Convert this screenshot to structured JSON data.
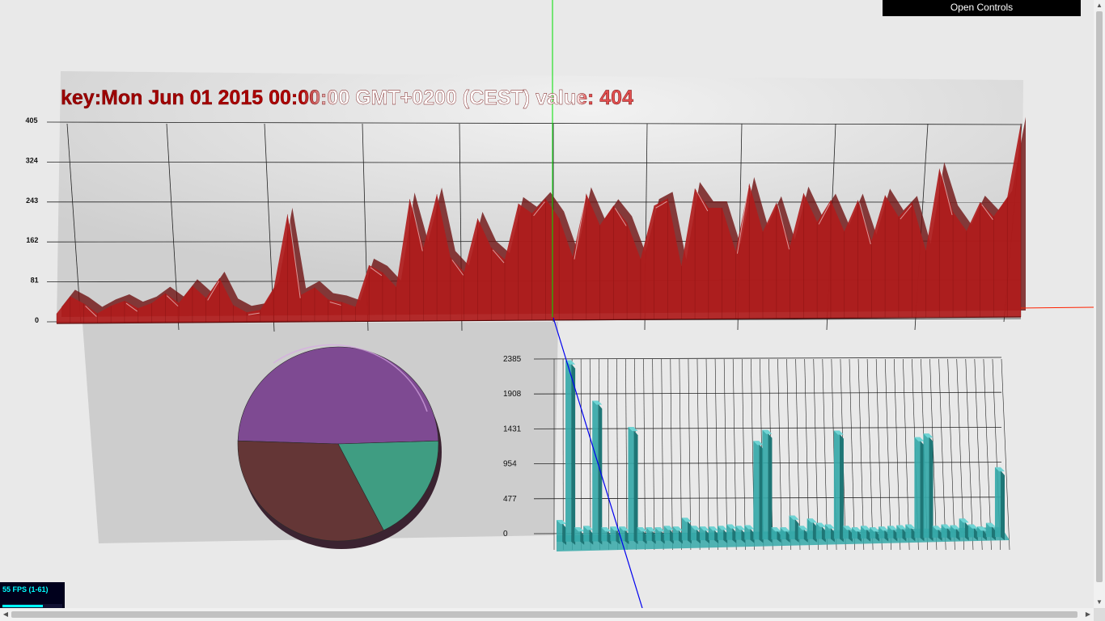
{
  "controls": {
    "open_label": "Open Controls"
  },
  "stats": {
    "fps_label": "55 FPS (1-61)",
    "fps_fill_fraction": 0.68
  },
  "tooltip": {
    "key_prefix": "key:",
    "key_value": "Mon Jun 01 2015 00:00:00 GMT+0200 (CEST)",
    "value_prefix": " value: ",
    "value": "404"
  },
  "colors": {
    "area": "#b01c1c",
    "pie_purple": "#7e4a92",
    "pie_maroon": "#643636",
    "pie_green": "#3f9d82",
    "bars": "#35a8a8",
    "axis_x": "#ff2200",
    "axis_y": "#00e000",
    "axis_z": "#0000ee"
  },
  "chart_data": [
    {
      "type": "area",
      "yticks": [
        "0",
        "81",
        "162",
        "243",
        "324",
        "405"
      ],
      "ylim": [
        0,
        405
      ],
      "grid": true,
      "values": [
        20,
        55,
        40,
        20,
        35,
        45,
        30,
        40,
        60,
        40,
        75,
        50,
        90,
        35,
        20,
        25,
        70,
        220,
        55,
        70,
        45,
        40,
        30,
        115,
        100,
        70,
        250,
        150,
        260,
        130,
        100,
        210,
        150,
        125,
        240,
        220,
        250,
        210,
        130,
        260,
        195,
        235,
        200,
        125,
        235,
        250,
        110,
        270,
        230,
        230,
        140,
        280,
        180,
        240,
        150,
        260,
        200,
        245,
        180,
        245,
        160,
        255,
        210,
        240,
        140,
        310,
        220,
        180,
        240,
        210,
        250,
        404
      ]
    },
    {
      "type": "pie",
      "slices": [
        {
          "name": "purple",
          "value": 49
        },
        {
          "name": "green",
          "value": 18
        },
        {
          "name": "maroon",
          "value": 33
        }
      ]
    },
    {
      "type": "bar",
      "yticks": [
        "0",
        "477",
        "954",
        "1431",
        "1908",
        "2385"
      ],
      "ylim": [
        0,
        2385
      ],
      "grid": true,
      "values": [
        120,
        2300,
        20,
        40,
        1750,
        20,
        30,
        30,
        1390,
        20,
        20,
        20,
        40,
        30,
        150,
        40,
        30,
        30,
        40,
        60,
        40,
        50,
        1200,
        1350,
        20,
        20,
        180,
        40,
        140,
        80,
        60,
        1340,
        40,
        20,
        40,
        20,
        30,
        40,
        50,
        60,
        1250,
        1300,
        40,
        60,
        50,
        140,
        60,
        30,
        80,
        840
      ]
    }
  ]
}
